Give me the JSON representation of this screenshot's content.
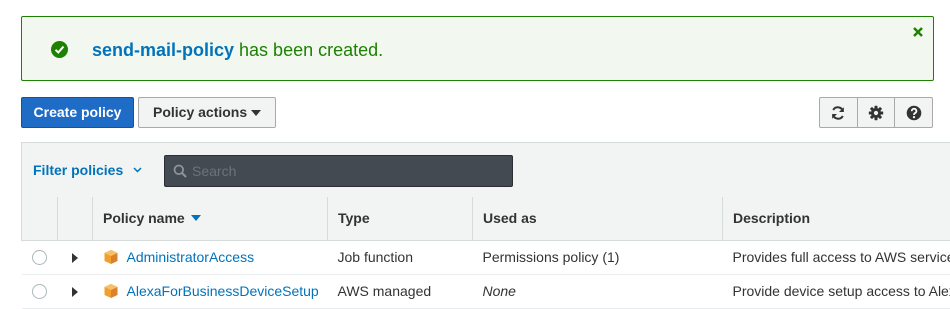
{
  "notification": {
    "policy_name": "send-mail-policy",
    "message": " has been created.",
    "status_color": "#1d8102"
  },
  "toolbar": {
    "create_label": "Create policy",
    "actions_label": "Policy actions",
    "icons": [
      "refresh-icon",
      "gear-icon",
      "help-icon"
    ]
  },
  "filter": {
    "label": "Filter policies",
    "search_placeholder": "Search"
  },
  "table": {
    "columns": [
      "Policy name",
      "Type",
      "Used as",
      "Description"
    ],
    "rows": [
      {
        "name": "AdministratorAccess",
        "type": "Job function",
        "used_as": "Permissions policy (1)",
        "description": "Provides full access to AWS services and resources."
      },
      {
        "name": "AlexaForBusinessDeviceSetup",
        "type": "AWS managed",
        "used_as": "None",
        "description": "Provide device setup access to AlexaForBusiness services"
      }
    ]
  },
  "colors": {
    "accent": "#0073bb",
    "primary_button": "#1f6cc7",
    "policy_icon": "#f0a030"
  }
}
